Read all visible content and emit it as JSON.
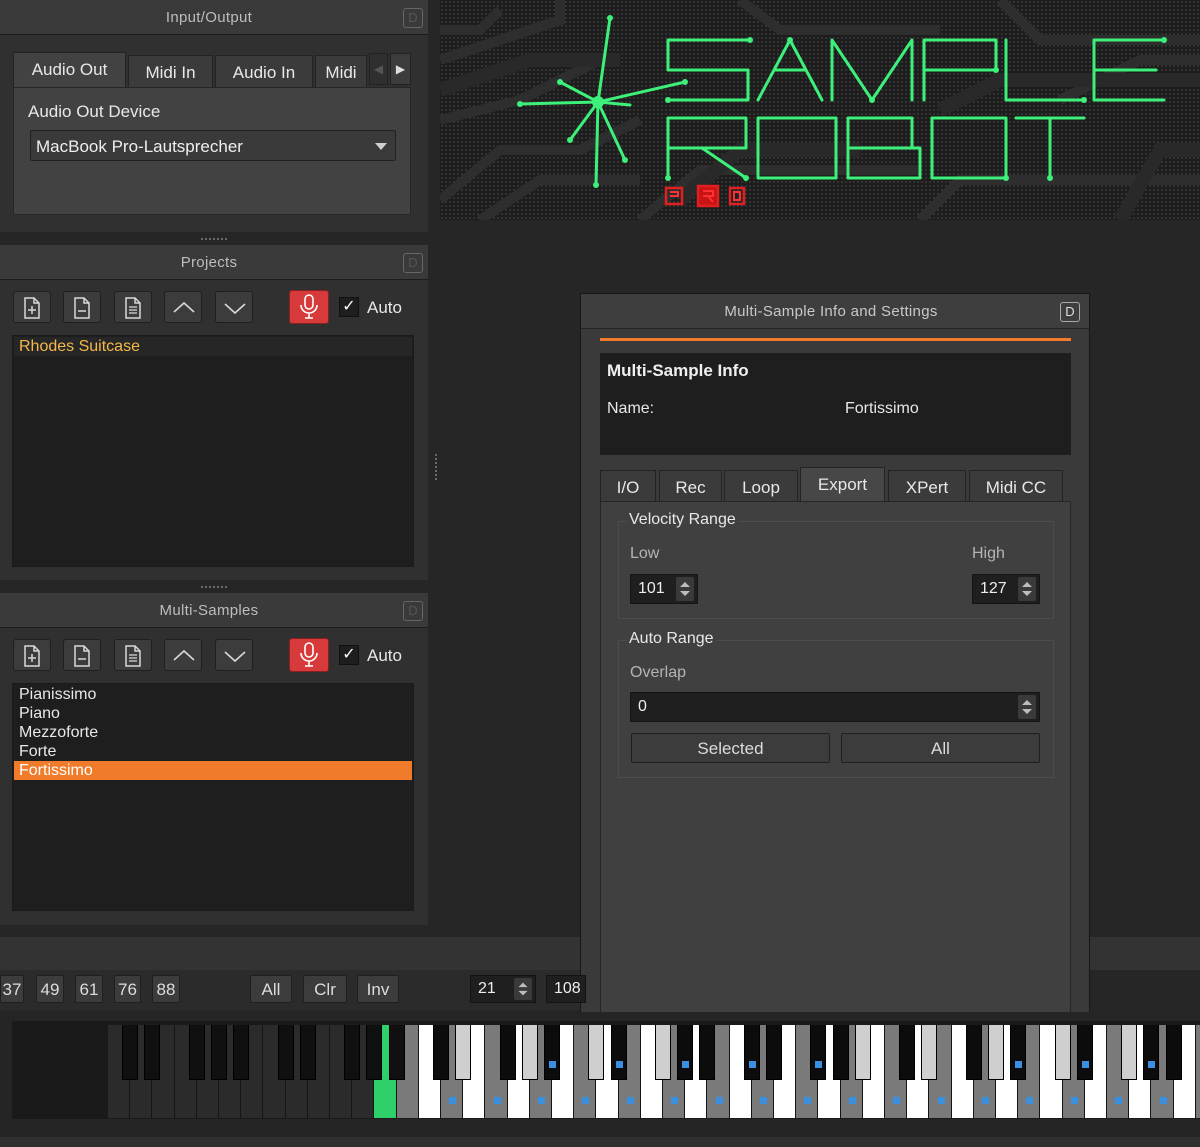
{
  "io_panel": {
    "title": "Input/Output",
    "d_label": "D",
    "tabs": [
      "Audio Out",
      "Midi In",
      "Audio In",
      "Midi"
    ],
    "device_label": "Audio Out Device",
    "device_value": "MacBook Pro-Lautsprecher"
  },
  "projects_panel": {
    "title": "Projects",
    "d_label": "D",
    "auto_label": "Auto",
    "check_mark": "✓",
    "items": [
      "Rhodes Suitcase"
    ]
  },
  "multisamples_panel": {
    "title": "Multi-Samples",
    "d_label": "D",
    "auto_label": "Auto",
    "check_mark": "✓",
    "items": [
      "Pianissimo",
      "Piano",
      "Mezzoforte",
      "Forte",
      "Fortissimo"
    ],
    "selected": "Fortissimo"
  },
  "dialog": {
    "title": "Multi-Sample Info and Settings",
    "d_label": "D",
    "info_heading": "Multi-Sample Info",
    "name_label": "Name:",
    "name_value": "Fortissimo",
    "tabs": [
      "I/O",
      "Rec",
      "Loop",
      "Export",
      "XPert",
      "Midi CC"
    ],
    "active_tab": "Export",
    "velocity_range": {
      "label": "Velocity Range",
      "low_label": "Low",
      "high_label": "High",
      "low_value": "101",
      "high_value": "127"
    },
    "auto_range": {
      "label": "Auto Range",
      "overlap_label": "Overlap",
      "overlap_value": "0",
      "selected_button": "Selected",
      "all_button": "All"
    }
  },
  "keyboard_toolbar": {
    "key_counts": [
      "37",
      "49",
      "61",
      "76",
      "88"
    ],
    "all_label": "All",
    "clr_label": "Clr",
    "inv_label": "Inv",
    "range_low": "21",
    "range_high": "108"
  },
  "colors": {
    "accent_orange": "#f07b2a",
    "project_text": "#f5b94a",
    "mic_red": "#d63a3a",
    "key_green": "#2fcf6a",
    "key_blue_dot": "#3a8fe0",
    "logo_green": "#3cf07a"
  }
}
